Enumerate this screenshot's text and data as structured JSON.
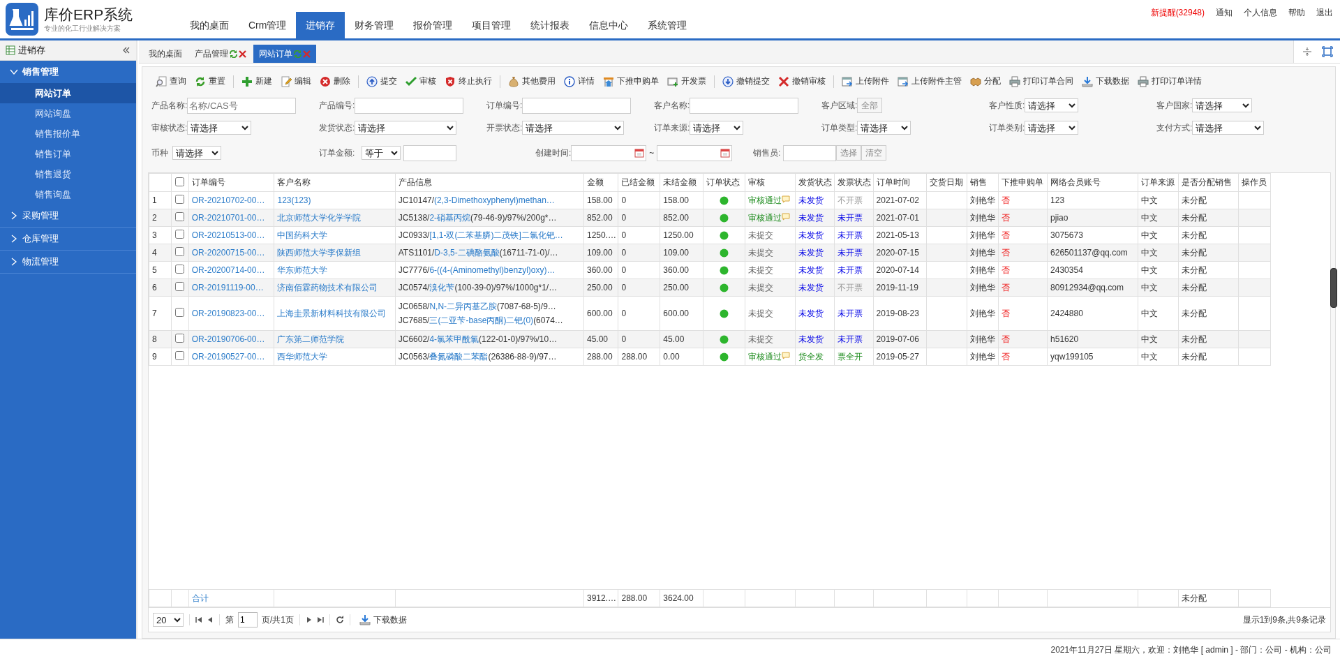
{
  "header": {
    "title": "库价ERP系统",
    "subtitle": "专业的化工行业解决方案",
    "nav": [
      {
        "label": "我的桌面",
        "selected": false
      },
      {
        "label": "Crm管理",
        "selected": false
      },
      {
        "label": "进销存",
        "selected": true
      },
      {
        "label": "财务管理",
        "selected": false
      },
      {
        "label": "报价管理",
        "selected": false
      },
      {
        "label": "项目管理",
        "selected": false
      },
      {
        "label": "统计报表",
        "selected": false
      },
      {
        "label": "信息中心",
        "selected": false
      },
      {
        "label": "系统管理",
        "selected": false
      }
    ],
    "links": [
      {
        "label": "新提醒(32948)",
        "alert": true
      },
      {
        "label": "通知",
        "alert": false
      },
      {
        "label": "个人信息",
        "alert": false
      },
      {
        "label": "帮助",
        "alert": false
      },
      {
        "label": "退出",
        "alert": false
      }
    ]
  },
  "sidebar": {
    "title": "进销存",
    "sections": [
      {
        "label": "销售管理",
        "expanded": true,
        "children": [
          {
            "label": "网站订单",
            "selected": true
          },
          {
            "label": "网站询盘",
            "selected": false
          },
          {
            "label": "销售报价单",
            "selected": false
          },
          {
            "label": "销售订单",
            "selected": false
          },
          {
            "label": "销售退货",
            "selected": false
          },
          {
            "label": "销售询盘",
            "selected": false
          }
        ]
      },
      {
        "label": "采购管理",
        "expanded": false
      },
      {
        "label": "仓库管理",
        "expanded": false
      },
      {
        "label": "物流管理",
        "expanded": false
      }
    ]
  },
  "tabs": [
    {
      "label": "我的桌面",
      "selected": false,
      "closable": false
    },
    {
      "label": "产品管理",
      "selected": false,
      "closable": true
    },
    {
      "label": "网站订单",
      "selected": true,
      "closable": true
    }
  ],
  "toolbar": [
    [
      {
        "label": "查询",
        "kind": "query"
      },
      {
        "label": "重置",
        "kind": "reset"
      }
    ],
    [
      {
        "label": "新建",
        "kind": "add"
      },
      {
        "label": "编辑",
        "kind": "edit"
      },
      {
        "label": "删除",
        "kind": "delete"
      }
    ],
    [
      {
        "label": "提交",
        "kind": "submit"
      },
      {
        "label": "审核",
        "kind": "approve"
      },
      {
        "label": "终止执行",
        "kind": "stop"
      }
    ],
    [
      {
        "label": "其他费用",
        "kind": "fee"
      },
      {
        "label": "详情",
        "kind": "detail"
      },
      {
        "label": "下推申购单",
        "kind": "push"
      },
      {
        "label": "开发票",
        "kind": "invoice"
      }
    ],
    [
      {
        "label": "撤销提交",
        "kind": "revoke_submit"
      },
      {
        "label": "撤销审核",
        "kind": "revoke_audit"
      }
    ],
    [
      {
        "label": "上传附件",
        "kind": "upload"
      },
      {
        "label": "上传附件主管",
        "kind": "upload"
      },
      {
        "label": "分配",
        "kind": "assign"
      },
      {
        "label": "打印订单合同",
        "kind": "print"
      },
      {
        "label": "下载数据",
        "kind": "download"
      },
      {
        "label": "打印订单详情",
        "kind": "print"
      }
    ]
  ],
  "filters": [
    [
      {
        "label": "产品名称:",
        "kind": "text",
        "placeholder": "名称/CAS号"
      },
      {
        "label": "产品编号:",
        "kind": "text"
      },
      {
        "label": "订单编号:",
        "kind": "text"
      },
      {
        "label": "客户名称:",
        "kind": "text"
      },
      {
        "label": "客户区域:",
        "kind": "button",
        "value": "全部"
      },
      {
        "label": "客户性质:",
        "kind": "select",
        "value": "请选择"
      },
      {
        "label": "客户国家:",
        "kind": "select",
        "value": "请选择"
      }
    ],
    [
      {
        "label": "审核状态:",
        "kind": "select",
        "value": "请选择"
      },
      {
        "label": "发货状态:",
        "kind": "select",
        "value": "请选择"
      },
      {
        "label": "开票状态:",
        "kind": "select",
        "value": "请选择"
      },
      {
        "label": "订单来源:",
        "kind": "select",
        "value": "请选择"
      },
      {
        "label": "订单类型:",
        "kind": "select",
        "value": "请选择"
      },
      {
        "label": "订单类别:",
        "kind": "select",
        "value": "请选择"
      },
      {
        "label": "支付方式:",
        "kind": "select",
        "value": "请选择"
      }
    ],
    [
      {
        "label": "币种",
        "kind": "select",
        "value": "请选择"
      },
      {
        "label": "订单金额:",
        "kind": "amount",
        "value": "等于"
      },
      {
        "label": "创建时间:",
        "kind": "daterange",
        "separator": "~"
      },
      {
        "label": "销售员:",
        "kind": "picker",
        "buttons": [
          "选择",
          "清空"
        ]
      }
    ]
  ],
  "table": {
    "select_all_checked": false,
    "columns": [
      "订单编号",
      "客户名称",
      "产品信息",
      "金额",
      "已结金额",
      "未结金额",
      "订单状态",
      "审核",
      "发货状态",
      "发票状态",
      "订单时间",
      "交货日期",
      "销售",
      "下推申购单",
      "网络会员账号",
      "订单来源",
      "是否分配销售",
      "操作员"
    ],
    "rows": [
      {
        "num": "1",
        "checked": false,
        "order_no": "OR-20210702-00…",
        "customer": "123(123)",
        "product": [
          {
            "code": "JC10147/",
            "name": "(2,3-Dimethoxyphenyl)methan…"
          }
        ],
        "amount": "158.00",
        "settled": "0",
        "unsettled": "158.00",
        "color": "#2db52d",
        "audit": {
          "text": "审核通过",
          "approved": true,
          "comment": true
        },
        "shipping": {
          "text": "未发货",
          "complete": false
        },
        "invoice": {
          "text": "不开票",
          "required": false
        },
        "order_time": "2021-07-02",
        "sales": "刘艳华",
        "push": "否",
        "member": "123",
        "source": "中文",
        "assigned": "未分配"
      },
      {
        "num": "2",
        "checked": false,
        "order_no": "OR-20210701-00…",
        "customer": "北京师范大学化学学院",
        "product": [
          {
            "code": "JC5138/",
            "name": "2-硝基丙烷",
            "rest": "(79-46-9)/97%/200g*…"
          }
        ],
        "amount": "852.00",
        "settled": "0",
        "unsettled": "852.00",
        "color": "#2db52d",
        "audit": {
          "text": "审核通过",
          "approved": true,
          "comment": true
        },
        "shipping": {
          "text": "未发货",
          "complete": false
        },
        "invoice": {
          "text": "未开票",
          "required": true,
          "issued": false
        },
        "order_time": "2021-07-01",
        "sales": "刘艳华",
        "push": "否",
        "member": "pjiao",
        "source": "中文",
        "assigned": "未分配"
      },
      {
        "num": "3",
        "checked": false,
        "order_no": "OR-20210513-00…",
        "customer": "中国药科大学",
        "product": [
          {
            "code": "JC0933/",
            "name": "[1,1-双(二苯基膦)二茂铁]二氯化钯…"
          }
        ],
        "amount": "1250.…",
        "settled": "0",
        "unsettled": "1250.00",
        "color": "#2db52d",
        "audit": {
          "text": "未提交",
          "approved": false,
          "comment": false
        },
        "shipping": {
          "text": "未发货",
          "complete": false
        },
        "invoice": {
          "text": "未开票",
          "required": true,
          "issued": false
        },
        "order_time": "2021-05-13",
        "sales": "刘艳华",
        "push": "否",
        "member": "3075673",
        "source": "中文",
        "assigned": "未分配"
      },
      {
        "num": "4",
        "checked": false,
        "order_no": "OR-20200715-00…",
        "customer": "陕西师范大学李保新组",
        "product": [
          {
            "code": "ATS1101/",
            "name": "D-3,5-二碘酪氨酸",
            "rest": "(16711-71-0)/…"
          }
        ],
        "amount": "109.00",
        "settled": "0",
        "unsettled": "109.00",
        "color": "#2db52d",
        "audit": {
          "text": "未提交",
          "approved": false,
          "comment": false
        },
        "shipping": {
          "text": "未发货",
          "complete": false
        },
        "invoice": {
          "text": "未开票",
          "required": true,
          "issued": false
        },
        "order_time": "2020-07-15",
        "sales": "刘艳华",
        "push": "否",
        "member": "626501137@qq.com",
        "source": "中文",
        "assigned": "未分配"
      },
      {
        "num": "5",
        "checked": false,
        "order_no": "OR-20200714-00…",
        "customer": "华东师范大学",
        "product": [
          {
            "code": "JC7776/",
            "name": "6-((4-(Aminomethyl)benzyl)oxy)…"
          }
        ],
        "amount": "360.00",
        "settled": "0",
        "unsettled": "360.00",
        "color": "#2db52d",
        "audit": {
          "text": "未提交",
          "approved": false,
          "comment": false
        },
        "shipping": {
          "text": "未发货",
          "complete": false
        },
        "invoice": {
          "text": "未开票",
          "required": true,
          "issued": false
        },
        "order_time": "2020-07-14",
        "sales": "刘艳华",
        "push": "否",
        "member": "2430354",
        "source": "中文",
        "assigned": "未分配"
      },
      {
        "num": "6",
        "checked": false,
        "order_no": "OR-20191119-00…",
        "customer": "济南佰霖药物技术有限公司",
        "product": [
          {
            "code": "JC0574/",
            "name": "溴化苄",
            "rest": "(100-39-0)/97%/1000g*1/…"
          }
        ],
        "amount": "250.00",
        "settled": "0",
        "unsettled": "250.00",
        "color": "#2db52d",
        "audit": {
          "text": "未提交",
          "approved": false,
          "comment": false
        },
        "shipping": {
          "text": "未发货",
          "complete": false
        },
        "invoice": {
          "text": "不开票",
          "required": false
        },
        "order_time": "2019-11-19",
        "sales": "刘艳华",
        "push": "否",
        "member": "80912934@qq.com",
        "source": "中文",
        "assigned": "未分配"
      },
      {
        "num": "7",
        "checked": false,
        "order_no": "OR-20190823-00…",
        "customer": "上海圭景新材料科技有限公司",
        "product": [
          {
            "code": "JC0658/",
            "name": "N,N-二异丙基乙胺",
            "rest": "(7087-68-5)/9…"
          },
          {
            "code": "JC7685/",
            "name": "三(二亚苄-base丙酮)二钯(0)",
            "rest": "(6074…"
          }
        ],
        "amount": "600.00",
        "settled": "0",
        "unsettled": "600.00",
        "color": "#2db52d",
        "audit": {
          "text": "未提交",
          "approved": false,
          "comment": false
        },
        "shipping": {
          "text": "未发货",
          "complete": false
        },
        "invoice": {
          "text": "未开票",
          "required": true,
          "issued": false
        },
        "order_time": "2019-08-23",
        "sales": "刘艳华",
        "push": "否",
        "member": "2424880",
        "source": "中文",
        "assigned": "未分配"
      },
      {
        "num": "8",
        "checked": false,
        "order_no": "OR-20190706-00…",
        "customer": "广东第二师范学院",
        "product": [
          {
            "code": "JC6602/",
            "name": "4-氯苯甲酰氯",
            "rest": "(122-01-0)/97%/10…"
          }
        ],
        "amount": "45.00",
        "settled": "0",
        "unsettled": "45.00",
        "color": "#2db52d",
        "audit": {
          "text": "未提交",
          "approved": false,
          "comment": false
        },
        "shipping": {
          "text": "未发货",
          "complete": false
        },
        "invoice": {
          "text": "未开票",
          "required": true,
          "issued": false
        },
        "order_time": "2019-07-06",
        "sales": "刘艳华",
        "push": "否",
        "member": "h51620",
        "source": "中文",
        "assigned": "未分配"
      },
      {
        "num": "9",
        "checked": false,
        "order_no": "OR-20190527-00…",
        "customer": "西华师范大学",
        "product": [
          {
            "code": "JC0563/",
            "name": "叠氮磷酸二苯酯",
            "rest": "(26386-88-9)/97…"
          }
        ],
        "amount": "288.00",
        "settled": "288.00",
        "unsettled": "0.00",
        "color": "#2db52d",
        "audit": {
          "text": "审核通过",
          "approved": true,
          "comment": true
        },
        "shipping": {
          "text": "货全发",
          "complete": true
        },
        "invoice": {
          "text": "票全开",
          "required": true,
          "issued": true
        },
        "order_time": "2019-05-27",
        "sales": "刘艳华",
        "push": "否",
        "member": "yqw199105",
        "source": "中文",
        "assigned": "未分配"
      }
    ],
    "total": {
      "label": "合计",
      "amount": "3912.…",
      "settled": "288.00",
      "unsettled": "3624.00",
      "assigned": "未分配"
    }
  },
  "pager": {
    "page_size": "20",
    "page_prefix": "第",
    "page": "1",
    "page_suffix": "页/共1页",
    "download": "下载数据",
    "summary": "显示1到9条,共9条记录"
  },
  "status_bar": "2021年11月27日 星期六，欢迎：刘艳华 [ admin ] - 部门：公司 - 机构：公司"
}
